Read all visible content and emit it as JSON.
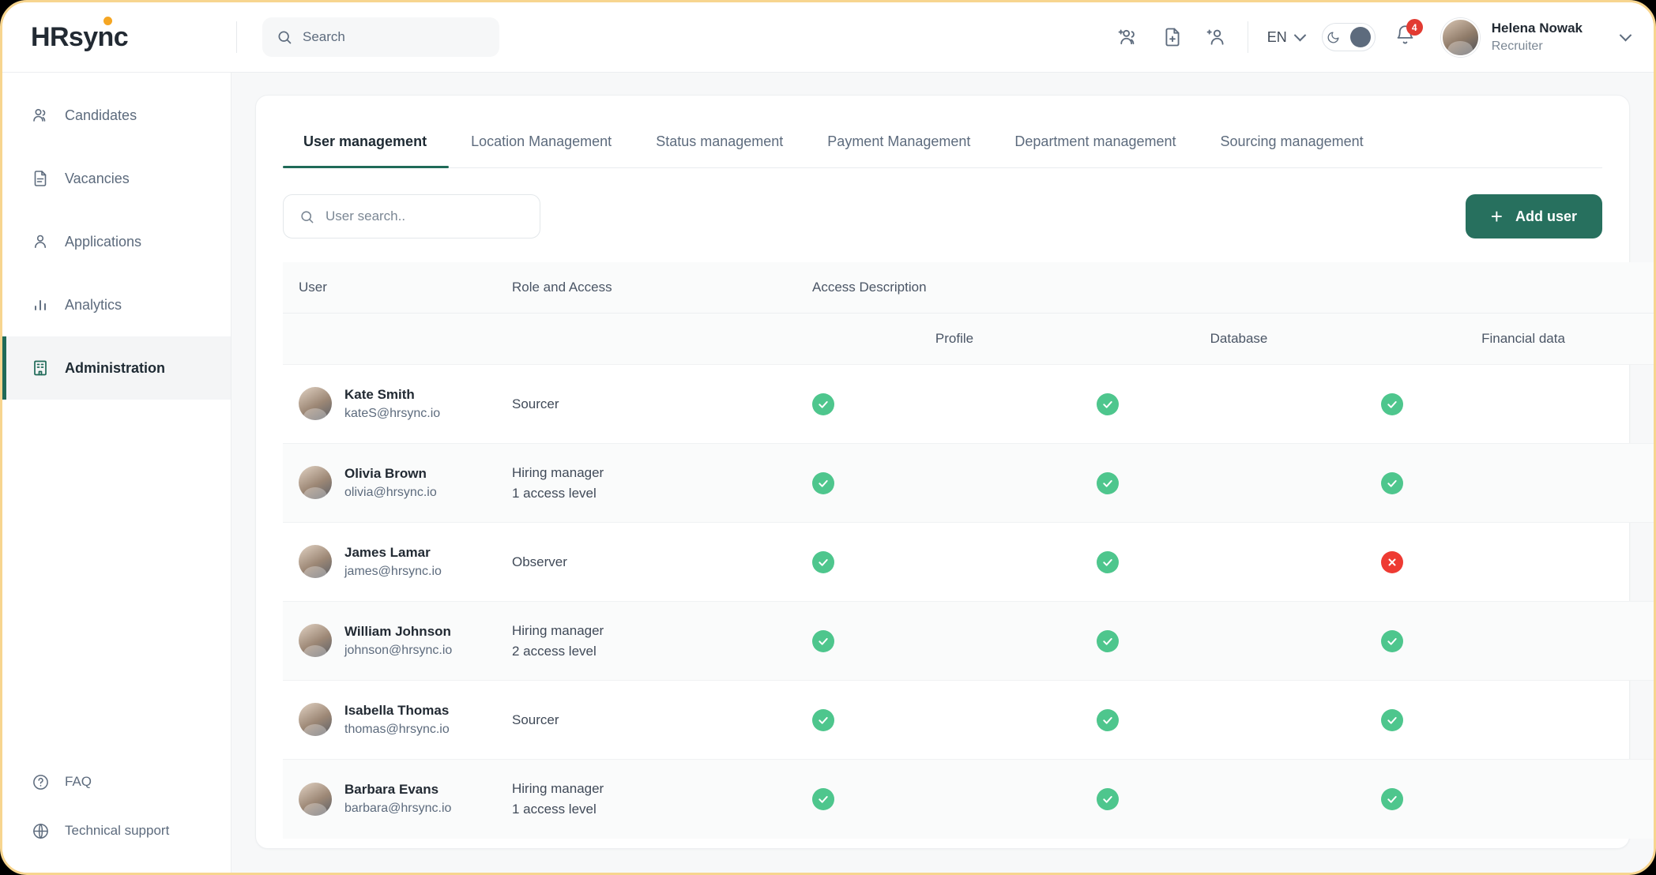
{
  "brand": {
    "name_primary": "HRs",
    "name_secondary": "ync",
    "full": "HRsync",
    "dot_color": "#f5a623"
  },
  "header": {
    "search_placeholder": "Search",
    "icons": [
      "add-group-icon",
      "add-document-icon",
      "add-person-icon"
    ],
    "language": "EN",
    "theme_toggle": {
      "icon": "moon-icon",
      "state": "on"
    },
    "notifications_count": "4",
    "user": {
      "name": "Helena Nowak",
      "role": "Recruiter"
    }
  },
  "sidebar": {
    "items": [
      {
        "label": "Candidates",
        "icon": "users-icon",
        "active": false
      },
      {
        "label": "Vacancies",
        "icon": "document-icon",
        "active": false
      },
      {
        "label": "Applications",
        "icon": "person-icon",
        "active": false
      },
      {
        "label": "Analytics",
        "icon": "bar-chart-icon",
        "active": false
      },
      {
        "label": "Administration",
        "icon": "building-icon",
        "active": true
      }
    ],
    "bottom_items": [
      {
        "label": "FAQ",
        "icon": "question-circle-icon"
      },
      {
        "label": "Technical support",
        "icon": "globe-icon"
      }
    ]
  },
  "main": {
    "tabs": [
      {
        "label": "User management",
        "active": true
      },
      {
        "label": "Location Management",
        "active": false
      },
      {
        "label": "Status management",
        "active": false
      },
      {
        "label": "Payment Management",
        "active": false
      },
      {
        "label": "Department management",
        "active": false
      },
      {
        "label": "Sourcing management",
        "active": false
      }
    ],
    "toolbar": {
      "search_placeholder": "User search..",
      "add_user_label": "Add user",
      "add_user_color": "#27705e"
    },
    "table": {
      "headers_main": [
        "User",
        "Role and Access",
        "Access Description"
      ],
      "headers_sub": [
        "Profile",
        "Database",
        "Financial data"
      ],
      "rows": [
        {
          "name": "Kate Smith",
          "email": "kateS@hrsync.io",
          "role": "Sourcer",
          "access_level": "",
          "profile": "granted",
          "database": "granted",
          "financial": "granted",
          "expandable": false
        },
        {
          "name": "Olivia Brown",
          "email": "olivia@hrsync.io",
          "role": "Hiring manager",
          "access_level": "1 access level",
          "profile": "granted",
          "database": "granted",
          "financial": "granted",
          "expandable": false
        },
        {
          "name": "James Lamar",
          "email": "james@hrsync.io",
          "role": "Observer",
          "access_level": "",
          "profile": "granted",
          "database": "granted",
          "financial": "denied",
          "expandable": true
        },
        {
          "name": "William Johnson",
          "email": "johnson@hrsync.io",
          "role": "Hiring manager",
          "access_level": "2 access level",
          "profile": "granted",
          "database": "granted",
          "financial": "granted",
          "expandable": false
        },
        {
          "name": "Isabella Thomas",
          "email": "thomas@hrsync.io",
          "role": "Sourcer",
          "access_level": "",
          "profile": "granted",
          "database": "granted",
          "financial": "granted",
          "expandable": false
        },
        {
          "name": "Barbara Evans",
          "email": "barbara@hrsync.io",
          "role": "Hiring manager",
          "access_level": "1 access level",
          "profile": "granted",
          "database": "granted",
          "financial": "granted",
          "expandable": false
        }
      ]
    }
  },
  "colors": {
    "granted": "#4ec68d",
    "denied": "#ee3b33",
    "accent": "#1f6a58",
    "frame_border": "#f7d58f"
  }
}
